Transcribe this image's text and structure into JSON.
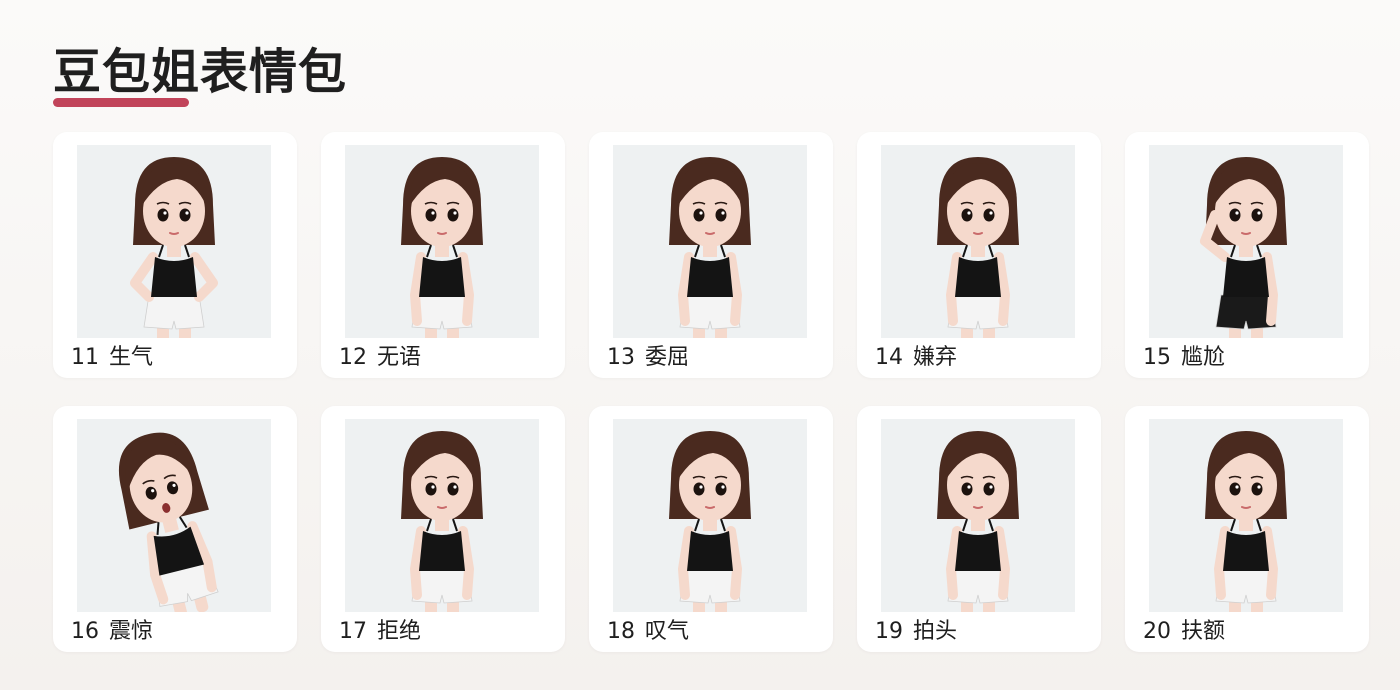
{
  "page": {
    "title": "豆包姐表情包",
    "accent_color": "#c1445a"
  },
  "stickers": [
    {
      "number": "11",
      "label": "生气",
      "pose": "hands-on-hips",
      "shorts": "white"
    },
    {
      "number": "12",
      "label": "无语",
      "pose": "standing",
      "shorts": "white"
    },
    {
      "number": "13",
      "label": "委屈",
      "pose": "standing",
      "shorts": "white"
    },
    {
      "number": "14",
      "label": "嫌弃",
      "pose": "standing",
      "shorts": "white"
    },
    {
      "number": "15",
      "label": "尴尬",
      "pose": "hand-on-head",
      "shorts": "black"
    },
    {
      "number": "16",
      "label": "震惊",
      "pose": "leaning",
      "shorts": "white"
    },
    {
      "number": "17",
      "label": "拒绝",
      "pose": "standing",
      "shorts": "white"
    },
    {
      "number": "18",
      "label": "叹气",
      "pose": "standing",
      "shorts": "white"
    },
    {
      "number": "19",
      "label": "拍头",
      "pose": "standing",
      "shorts": "white"
    },
    {
      "number": "20",
      "label": "扶额",
      "pose": "standing",
      "shorts": "white"
    }
  ]
}
